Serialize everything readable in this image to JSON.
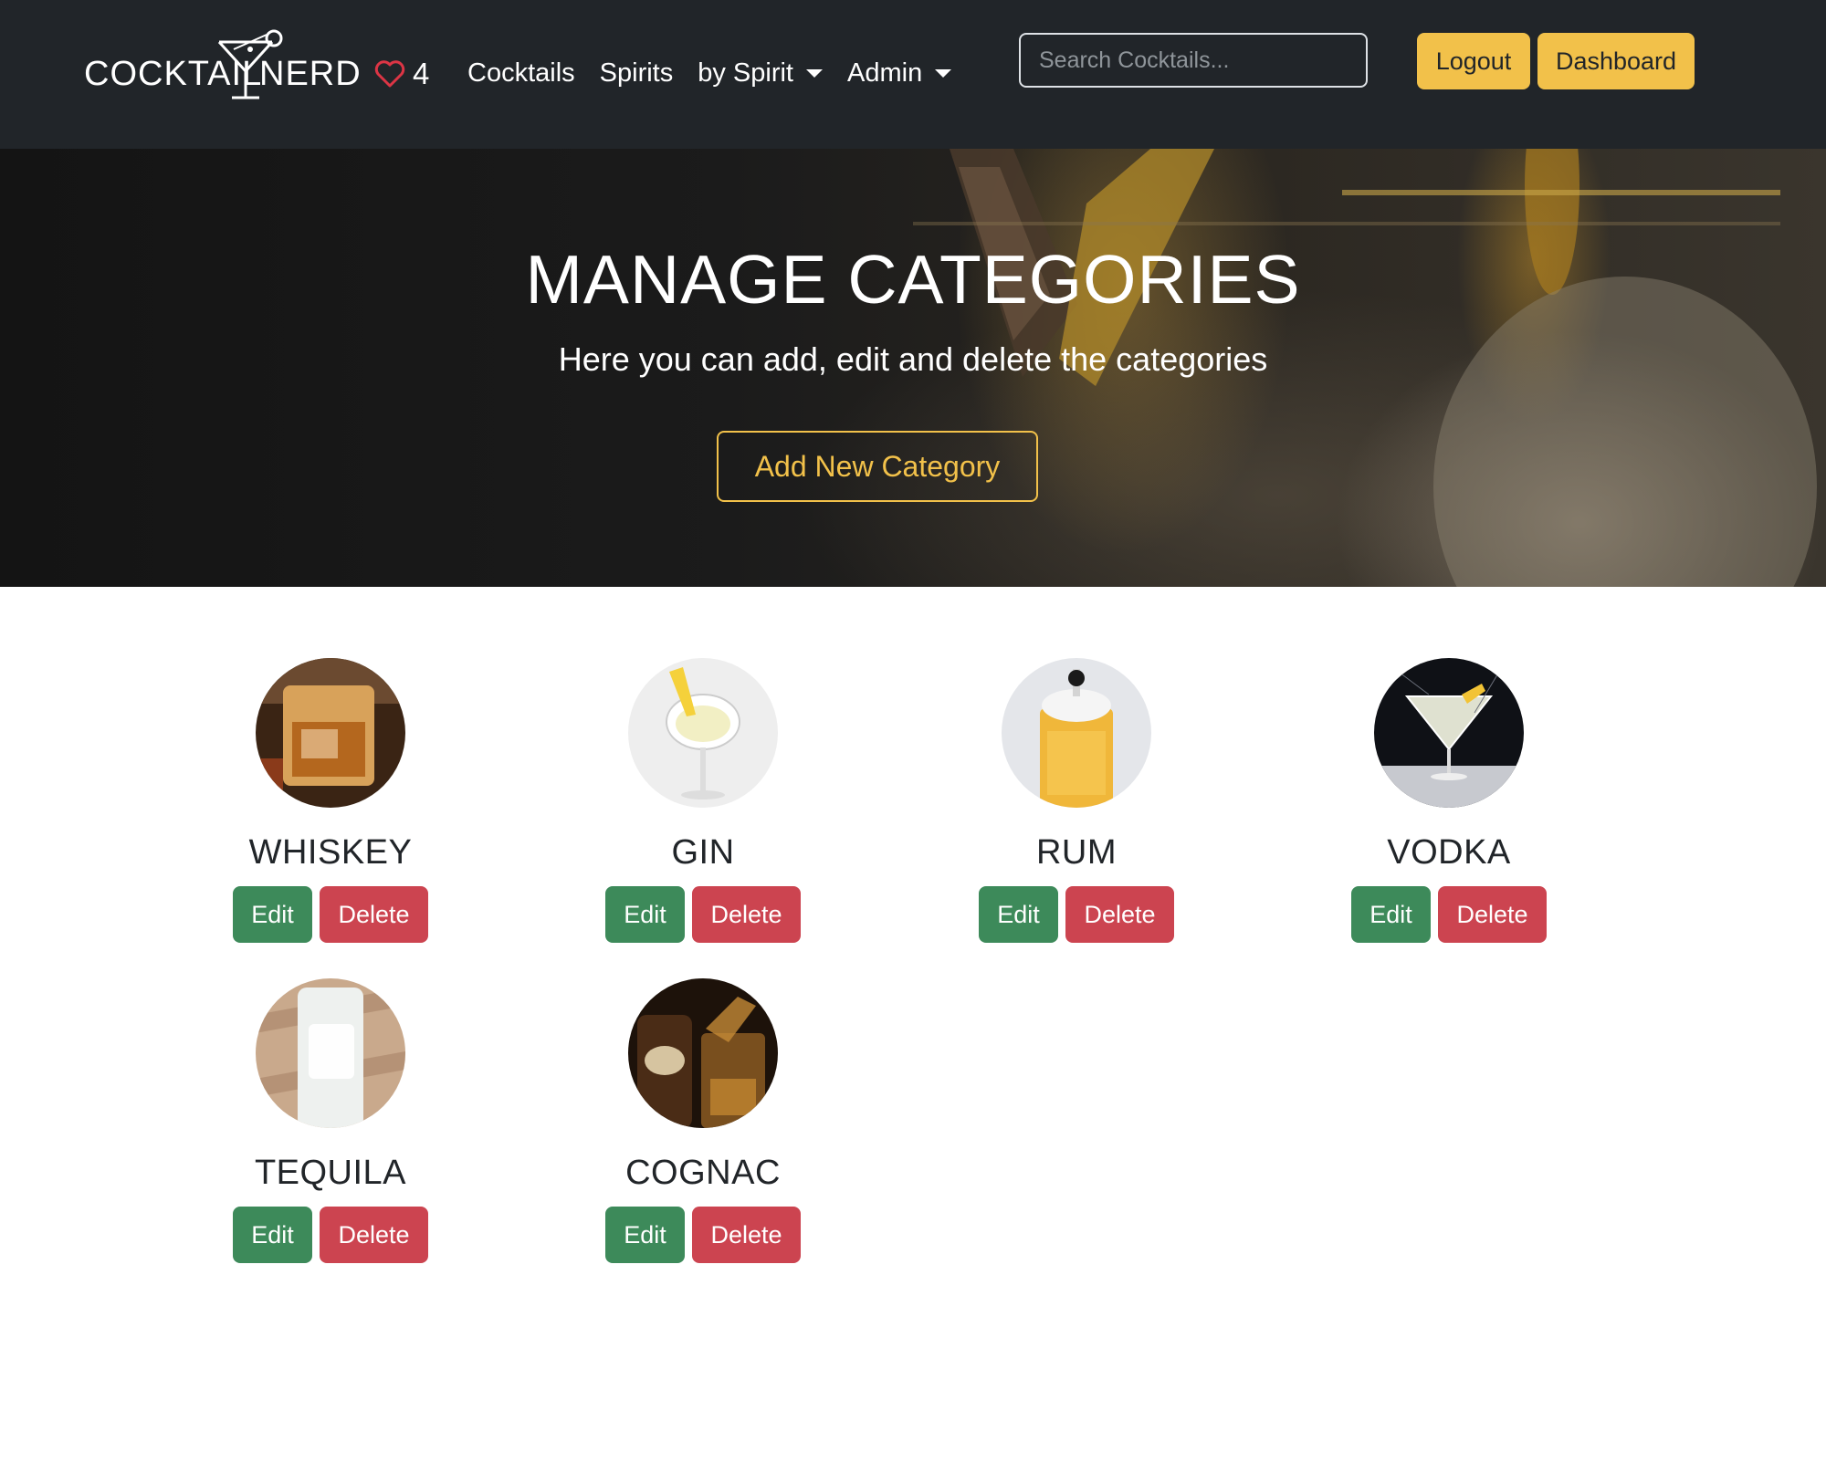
{
  "brand": {
    "left": "COCKTAIL",
    "right": "NERD"
  },
  "favorites": {
    "icon": "heart-icon",
    "count": "4",
    "color": "#dc3545"
  },
  "nav": {
    "cocktails": "Cocktails",
    "spirits": "Spirits",
    "by_spirit": "by Spirit",
    "admin": "Admin"
  },
  "search": {
    "placeholder": "Search Cocktails..."
  },
  "header_buttons": {
    "logout": "Logout",
    "dashboard": "Dashboard"
  },
  "hero": {
    "title": "MANAGE CATEGORIES",
    "subtitle": "Here you can add, edit and delete the categories",
    "add_button": "Add New Category"
  },
  "categories": [
    {
      "name": "WHISKEY",
      "edit": "Edit",
      "delete": "Delete"
    },
    {
      "name": "GIN",
      "edit": "Edit",
      "delete": "Delete"
    },
    {
      "name": "RUM",
      "edit": "Edit",
      "delete": "Delete"
    },
    {
      "name": "VODKA",
      "edit": "Edit",
      "delete": "Delete"
    },
    {
      "name": "TEQUILA",
      "edit": "Edit",
      "delete": "Delete"
    },
    {
      "name": "COGNAC",
      "edit": "Edit",
      "delete": "Delete"
    }
  ],
  "colors": {
    "navbar": "#212529",
    "accent_yellow": "#f2c14a",
    "edit_green": "#3d8a5a",
    "delete_red": "#cc4450"
  }
}
